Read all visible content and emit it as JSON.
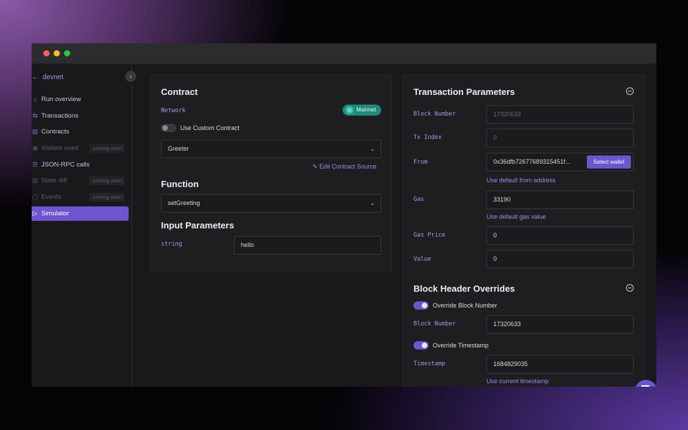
{
  "sidebar": {
    "back_label": "devnet",
    "items": [
      {
        "label": "Run overview",
        "icon": "home-icon"
      },
      {
        "label": "Transactions",
        "icon": "arrows-icon"
      },
      {
        "label": "Contracts",
        "icon": "file-icon"
      },
      {
        "label": "Wallets used",
        "icon": "wallet-icon",
        "badge": "coming soon"
      },
      {
        "label": "JSON-RPC calls",
        "icon": "list-icon"
      },
      {
        "label": "State diff",
        "icon": "doc-icon",
        "badge": "coming soon"
      },
      {
        "label": "Events",
        "icon": "bookmark-icon",
        "badge": "coming soon"
      },
      {
        "label": "Simulator",
        "icon": "play-icon"
      }
    ]
  },
  "contract": {
    "title": "Contract",
    "network_label": "Network",
    "network_value": "Mainnet",
    "custom_contract_label": "Use Custom Contract",
    "selected_contract": "Greeter",
    "edit_source_label": "Edit Contract Source",
    "function_title": "Function",
    "selected_function": "setGreeting",
    "input_params_title": "Input Parameters",
    "param_type": "string",
    "param_value": "hello"
  },
  "tx": {
    "title": "Transaction Parameters",
    "block_number_label": "Block Number",
    "block_number_value": "17320633",
    "tx_index_label": "Tx Index",
    "tx_index_value": "0",
    "from_label": "From",
    "from_value": "0x36dfb72677689315451f...",
    "select_wallet_label": "Select wallet",
    "default_from_link": "Use default from address",
    "gas_label": "Gas",
    "gas_value": "33190",
    "default_gas_link": "Use default gas value",
    "gas_price_label": "Gas Price",
    "gas_price_value": "0",
    "value_label": "Value",
    "value_value": "0"
  },
  "header": {
    "title": "Block Header Overrides",
    "override_block_label": "Override Block Number",
    "block_number_label": "Block Number",
    "block_number_value": "17320633",
    "override_timestamp_label": "Override Timestamp",
    "timestamp_label": "Timestamp",
    "timestamp_value": "1684829035",
    "current_timestamp_link": "Use current timestamp"
  },
  "colors": {
    "accent": "#6c55cf",
    "network_badge": "#1f8a7a"
  }
}
